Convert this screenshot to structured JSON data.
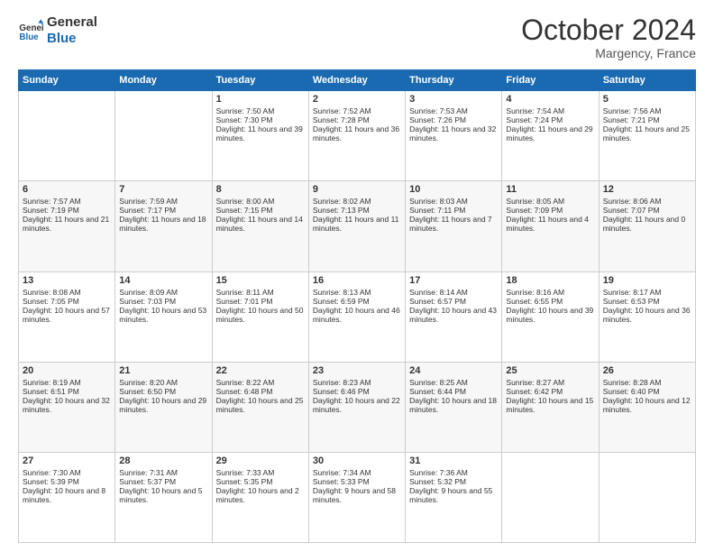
{
  "header": {
    "logo_line1": "General",
    "logo_line2": "Blue",
    "month_year": "October 2024",
    "location": "Margency, France"
  },
  "days_of_week": [
    "Sunday",
    "Monday",
    "Tuesday",
    "Wednesday",
    "Thursday",
    "Friday",
    "Saturday"
  ],
  "weeks": [
    [
      {
        "day": "",
        "content": ""
      },
      {
        "day": "",
        "content": ""
      },
      {
        "day": "1",
        "content": "Sunrise: 7:50 AM\nSunset: 7:30 PM\nDaylight: 11 hours and 39 minutes."
      },
      {
        "day": "2",
        "content": "Sunrise: 7:52 AM\nSunset: 7:28 PM\nDaylight: 11 hours and 36 minutes."
      },
      {
        "day": "3",
        "content": "Sunrise: 7:53 AM\nSunset: 7:26 PM\nDaylight: 11 hours and 32 minutes."
      },
      {
        "day": "4",
        "content": "Sunrise: 7:54 AM\nSunset: 7:24 PM\nDaylight: 11 hours and 29 minutes."
      },
      {
        "day": "5",
        "content": "Sunrise: 7:56 AM\nSunset: 7:21 PM\nDaylight: 11 hours and 25 minutes."
      }
    ],
    [
      {
        "day": "6",
        "content": "Sunrise: 7:57 AM\nSunset: 7:19 PM\nDaylight: 11 hours and 21 minutes."
      },
      {
        "day": "7",
        "content": "Sunrise: 7:59 AM\nSunset: 7:17 PM\nDaylight: 11 hours and 18 minutes."
      },
      {
        "day": "8",
        "content": "Sunrise: 8:00 AM\nSunset: 7:15 PM\nDaylight: 11 hours and 14 minutes."
      },
      {
        "day": "9",
        "content": "Sunrise: 8:02 AM\nSunset: 7:13 PM\nDaylight: 11 hours and 11 minutes."
      },
      {
        "day": "10",
        "content": "Sunrise: 8:03 AM\nSunset: 7:11 PM\nDaylight: 11 hours and 7 minutes."
      },
      {
        "day": "11",
        "content": "Sunrise: 8:05 AM\nSunset: 7:09 PM\nDaylight: 11 hours and 4 minutes."
      },
      {
        "day": "12",
        "content": "Sunrise: 8:06 AM\nSunset: 7:07 PM\nDaylight: 11 hours and 0 minutes."
      }
    ],
    [
      {
        "day": "13",
        "content": "Sunrise: 8:08 AM\nSunset: 7:05 PM\nDaylight: 10 hours and 57 minutes."
      },
      {
        "day": "14",
        "content": "Sunrise: 8:09 AM\nSunset: 7:03 PM\nDaylight: 10 hours and 53 minutes."
      },
      {
        "day": "15",
        "content": "Sunrise: 8:11 AM\nSunset: 7:01 PM\nDaylight: 10 hours and 50 minutes."
      },
      {
        "day": "16",
        "content": "Sunrise: 8:13 AM\nSunset: 6:59 PM\nDaylight: 10 hours and 46 minutes."
      },
      {
        "day": "17",
        "content": "Sunrise: 8:14 AM\nSunset: 6:57 PM\nDaylight: 10 hours and 43 minutes."
      },
      {
        "day": "18",
        "content": "Sunrise: 8:16 AM\nSunset: 6:55 PM\nDaylight: 10 hours and 39 minutes."
      },
      {
        "day": "19",
        "content": "Sunrise: 8:17 AM\nSunset: 6:53 PM\nDaylight: 10 hours and 36 minutes."
      }
    ],
    [
      {
        "day": "20",
        "content": "Sunrise: 8:19 AM\nSunset: 6:51 PM\nDaylight: 10 hours and 32 minutes."
      },
      {
        "day": "21",
        "content": "Sunrise: 8:20 AM\nSunset: 6:50 PM\nDaylight: 10 hours and 29 minutes."
      },
      {
        "day": "22",
        "content": "Sunrise: 8:22 AM\nSunset: 6:48 PM\nDaylight: 10 hours and 25 minutes."
      },
      {
        "day": "23",
        "content": "Sunrise: 8:23 AM\nSunset: 6:46 PM\nDaylight: 10 hours and 22 minutes."
      },
      {
        "day": "24",
        "content": "Sunrise: 8:25 AM\nSunset: 6:44 PM\nDaylight: 10 hours and 18 minutes."
      },
      {
        "day": "25",
        "content": "Sunrise: 8:27 AM\nSunset: 6:42 PM\nDaylight: 10 hours and 15 minutes."
      },
      {
        "day": "26",
        "content": "Sunrise: 8:28 AM\nSunset: 6:40 PM\nDaylight: 10 hours and 12 minutes."
      }
    ],
    [
      {
        "day": "27",
        "content": "Sunrise: 7:30 AM\nSunset: 5:39 PM\nDaylight: 10 hours and 8 minutes."
      },
      {
        "day": "28",
        "content": "Sunrise: 7:31 AM\nSunset: 5:37 PM\nDaylight: 10 hours and 5 minutes."
      },
      {
        "day": "29",
        "content": "Sunrise: 7:33 AM\nSunset: 5:35 PM\nDaylight: 10 hours and 2 minutes."
      },
      {
        "day": "30",
        "content": "Sunrise: 7:34 AM\nSunset: 5:33 PM\nDaylight: 9 hours and 58 minutes."
      },
      {
        "day": "31",
        "content": "Sunrise: 7:36 AM\nSunset: 5:32 PM\nDaylight: 9 hours and 55 minutes."
      },
      {
        "day": "",
        "content": ""
      },
      {
        "day": "",
        "content": ""
      }
    ]
  ]
}
